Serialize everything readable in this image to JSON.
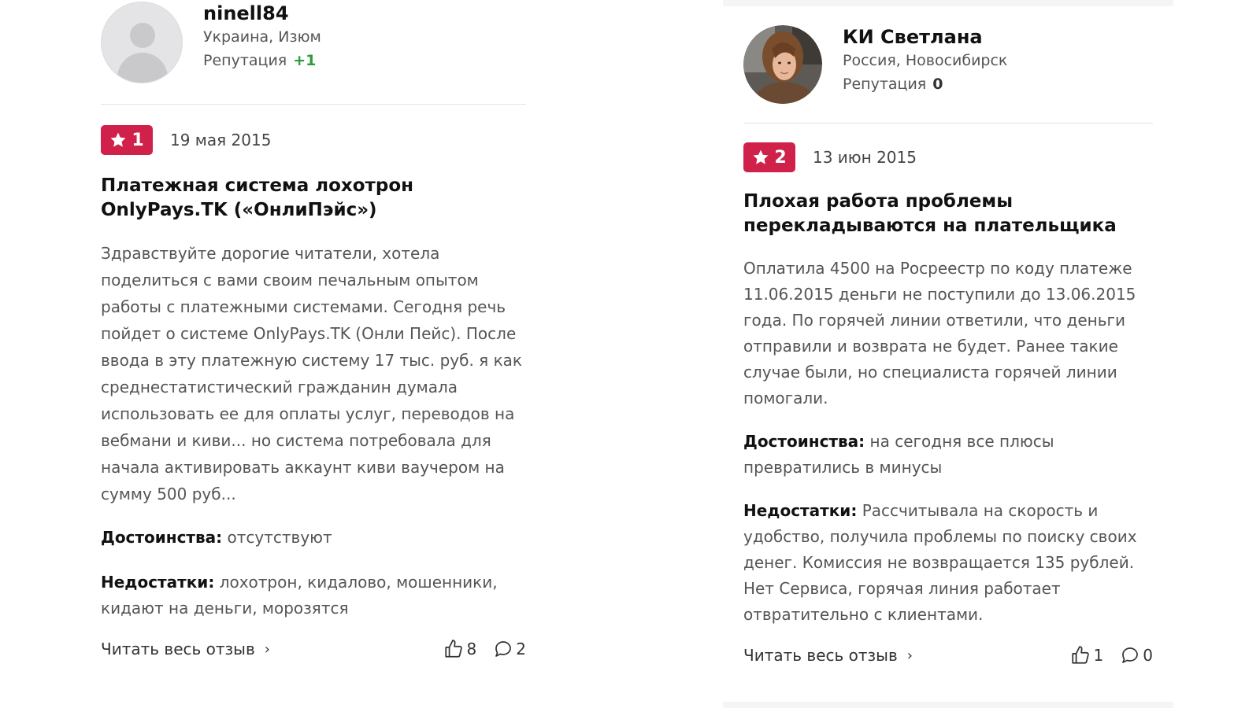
{
  "reviews": [
    {
      "author": {
        "name": "ninell84",
        "location": "Украина, Изюм",
        "reputation_label": "Репутация",
        "reputation_value": "+1",
        "avatar": "default-user-avatar"
      },
      "rating": "1",
      "date": "19 мая 2015",
      "title": "Платежная система лохотрон OnlyPays.TK («ОнлиПэйс»)",
      "text": "Здравствуйте дорогие читатели, хотела поделиться с вами своим печальным опытом работы с платежными системами. Сегодня речь пойдет о системе OnlyPays.TK (Онли Пейс). После ввода в эту платежную систему 17 тыс. руб. я как среднестатистический гражданин думала использовать ее для оплаты услуг, переводов на вебмани и киви... но система потребовала для начала активировать аккаунт киви ваучером на сумму 500 руб...",
      "pros_label": "Достоинства:",
      "pros": "отсутствуют",
      "cons_label": "Недостатки:",
      "cons": "лохотрон, кидалово, мошенники, кидают на деньги, морозятся",
      "read_more": "Читать весь отзыв",
      "likes": "8",
      "comments": "2"
    },
    {
      "author": {
        "name": "КИ Светлана",
        "location": "Россия, Новосибирск",
        "reputation_label": "Репутация",
        "reputation_value": "0",
        "avatar": "user-photo-avatar"
      },
      "rating": "2",
      "date": "13 июн 2015",
      "title": "Плохая работа проблемы перекладываются на плательщика",
      "text": "Оплатила 4500 на Росреестр по коду платеже 11.06.2015 деньги не поступили до 13.06.2015 года. По горячей линии ответили, что деньги отправили и возврата не будет. Ранее такие случае были, но специалиста горячей линии помогали.",
      "pros_label": "Достоинства:",
      "pros": "на сегодня все плюсы превратились в минусы",
      "cons_label": "Недостатки:",
      "cons": "Рассчитывала на скорость и удобство, получила проблемы по поиску своих денег. Комиссия не возвращается 135 рублей. Нет Сервиса, горячая линия работает отвратительно с клиентами.",
      "read_more": "Читать весь отзыв",
      "likes": "1",
      "comments": "0"
    }
  ],
  "colors": {
    "rating_badge": "#cf2149",
    "reputation_positive": "#2e9a3a",
    "muted_text": "#555555"
  }
}
